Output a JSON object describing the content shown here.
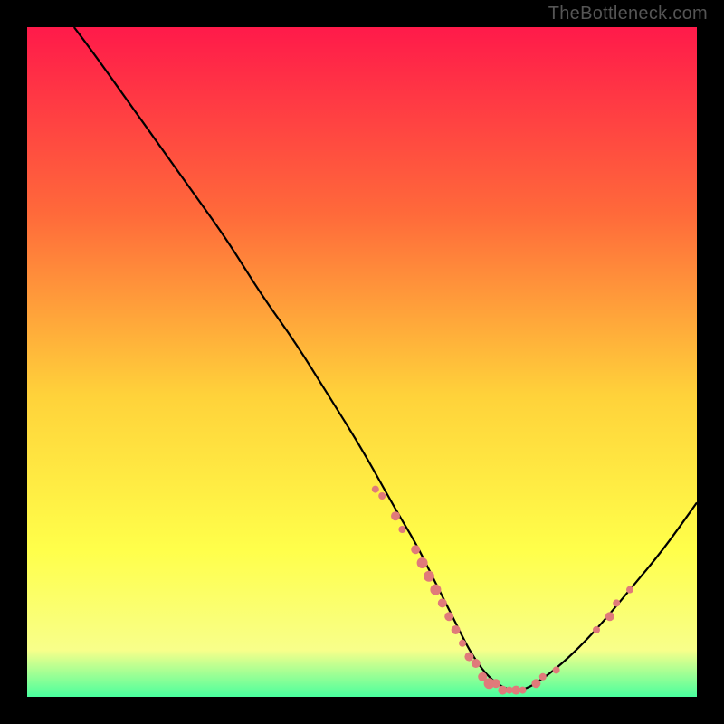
{
  "watermark": "TheBottleneck.com",
  "colors": {
    "gradient_top": "#ff1a4a",
    "gradient_mid1": "#ff6a3a",
    "gradient_mid2": "#ffd23a",
    "gradient_mid3": "#ffff4a",
    "gradient_bottom1": "#f8ff8a",
    "gradient_bottom2": "#49ff9e",
    "curve": "#000000",
    "markers": "#e07a7a"
  },
  "chart_data": {
    "type": "line",
    "title": "",
    "xlabel": "",
    "ylabel": "",
    "xlim": [
      0,
      100
    ],
    "ylim": [
      0,
      100
    ],
    "series": [
      {
        "name": "curve",
        "x": [
          7,
          10,
          15,
          20,
          25,
          30,
          35,
          40,
          45,
          50,
          55,
          58,
          60,
          62,
          64,
          66,
          68,
          70,
          72,
          74,
          76,
          80,
          85,
          90,
          95,
          100
        ],
        "y": [
          100,
          96,
          89,
          82,
          75,
          68,
          60,
          53,
          45,
          37,
          28,
          23,
          19,
          15,
          11,
          7,
          4,
          2,
          1,
          1,
          2,
          5,
          10,
          16,
          22,
          29
        ]
      }
    ],
    "markers": [
      {
        "x": 52,
        "y": 31,
        "r": 4
      },
      {
        "x": 53,
        "y": 30,
        "r": 4
      },
      {
        "x": 55,
        "y": 27,
        "r": 5
      },
      {
        "x": 56,
        "y": 25,
        "r": 4
      },
      {
        "x": 58,
        "y": 22,
        "r": 5
      },
      {
        "x": 59,
        "y": 20,
        "r": 6
      },
      {
        "x": 60,
        "y": 18,
        "r": 6
      },
      {
        "x": 61,
        "y": 16,
        "r": 6
      },
      {
        "x": 62,
        "y": 14,
        "r": 5
      },
      {
        "x": 63,
        "y": 12,
        "r": 5
      },
      {
        "x": 64,
        "y": 10,
        "r": 5
      },
      {
        "x": 65,
        "y": 8,
        "r": 4
      },
      {
        "x": 66,
        "y": 6,
        "r": 5
      },
      {
        "x": 67,
        "y": 5,
        "r": 5
      },
      {
        "x": 68,
        "y": 3,
        "r": 5
      },
      {
        "x": 69,
        "y": 2,
        "r": 6
      },
      {
        "x": 70,
        "y": 2,
        "r": 5
      },
      {
        "x": 71,
        "y": 1,
        "r": 5
      },
      {
        "x": 72,
        "y": 1,
        "r": 4
      },
      {
        "x": 73,
        "y": 1,
        "r": 5
      },
      {
        "x": 74,
        "y": 1,
        "r": 4
      },
      {
        "x": 76,
        "y": 2,
        "r": 5
      },
      {
        "x": 77,
        "y": 3,
        "r": 4
      },
      {
        "x": 79,
        "y": 4,
        "r": 4
      },
      {
        "x": 85,
        "y": 10,
        "r": 4
      },
      {
        "x": 87,
        "y": 12,
        "r": 5
      },
      {
        "x": 88,
        "y": 14,
        "r": 4
      },
      {
        "x": 90,
        "y": 16,
        "r": 4
      }
    ]
  }
}
